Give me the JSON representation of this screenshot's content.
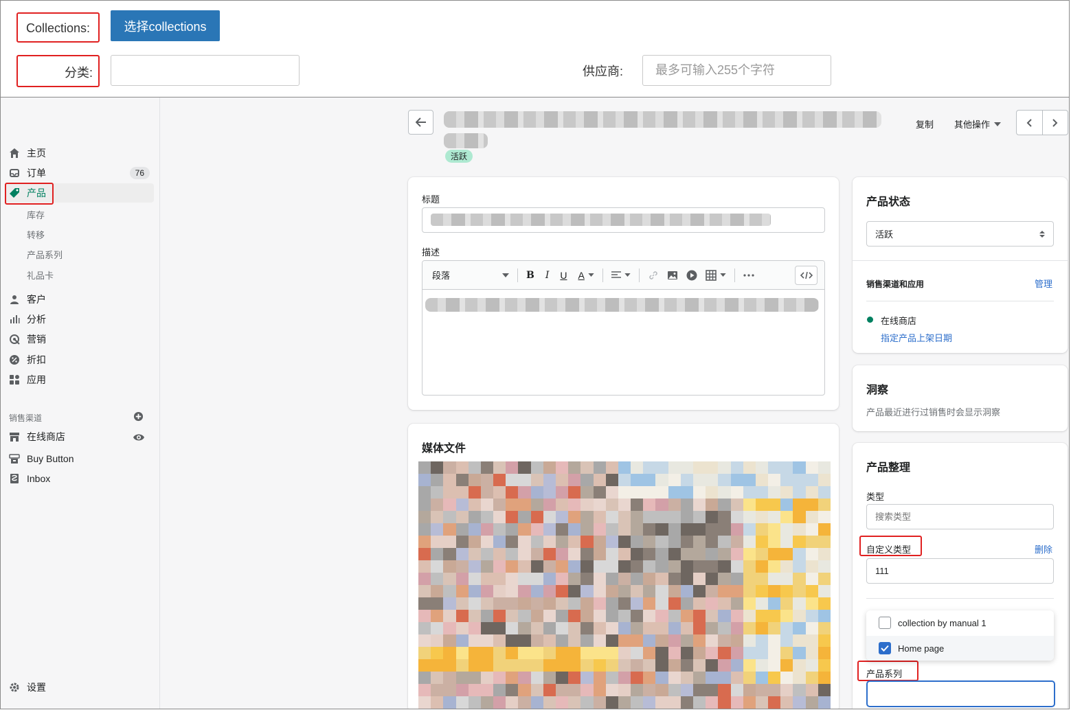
{
  "top_panel": {
    "collections_label": "Collections:",
    "select_collections_button": "选择collections",
    "category_label": "分类:",
    "vendor_label": "供应商:",
    "vendor_placeholder": "最多可输入255个字符"
  },
  "sidebar": {
    "items": [
      {
        "label": "主页",
        "icon": "home-icon"
      },
      {
        "label": "订单",
        "icon": "orders-icon",
        "badge": "76"
      },
      {
        "label": "产品",
        "icon": "tag-icon"
      },
      {
        "label": "客户",
        "icon": "customer-icon"
      },
      {
        "label": "分析",
        "icon": "analytics-icon"
      },
      {
        "label": "营销",
        "icon": "marketing-icon"
      },
      {
        "label": "折扣",
        "icon": "discount-icon"
      },
      {
        "label": "应用",
        "icon": "apps-icon"
      }
    ],
    "product_subitems": [
      "库存",
      "转移",
      "产品系列",
      "礼品卡"
    ],
    "sales_channels_title": "销售渠道",
    "channels": [
      {
        "label": "在线商店",
        "icon": "store-icon"
      },
      {
        "label": "Buy Button",
        "icon": "buy-button-icon"
      },
      {
        "label": "Inbox",
        "icon": "inbox-icon"
      }
    ],
    "settings_label": "设置"
  },
  "header": {
    "status": "活跃",
    "duplicate": "复制",
    "more_actions": "其他操作"
  },
  "product_card": {
    "title_label": "标题",
    "description_label": "描述",
    "paragraph_select": "段落"
  },
  "media_card": {
    "title": "媒体文件"
  },
  "status_card": {
    "title": "产品状态",
    "status_value": "活跃",
    "channels_title": "销售渠道和应用",
    "manage_link": "管理",
    "online_store": "在线商店",
    "schedule_link": "指定产品上架日期"
  },
  "insights_card": {
    "title": "洞察",
    "description": "产品最近进行过销售时会显示洞察"
  },
  "organization_card": {
    "title": "产品整理",
    "type_label": "类型",
    "type_placeholder": "搜索类型",
    "custom_type_label": "自定义类型",
    "delete_link": "删除",
    "custom_type_value": "111",
    "collections_label": "产品系列",
    "collection_options": [
      {
        "label": "collection by manual 1",
        "checked": false
      },
      {
        "label": "Home page",
        "checked": true
      }
    ]
  },
  "colors": {
    "primary_button": "#2a76b6",
    "highlight_red": "#e02020",
    "active_green": "#008060",
    "link_blue": "#2c6ecb",
    "status_badge": "#aee9d1"
  }
}
